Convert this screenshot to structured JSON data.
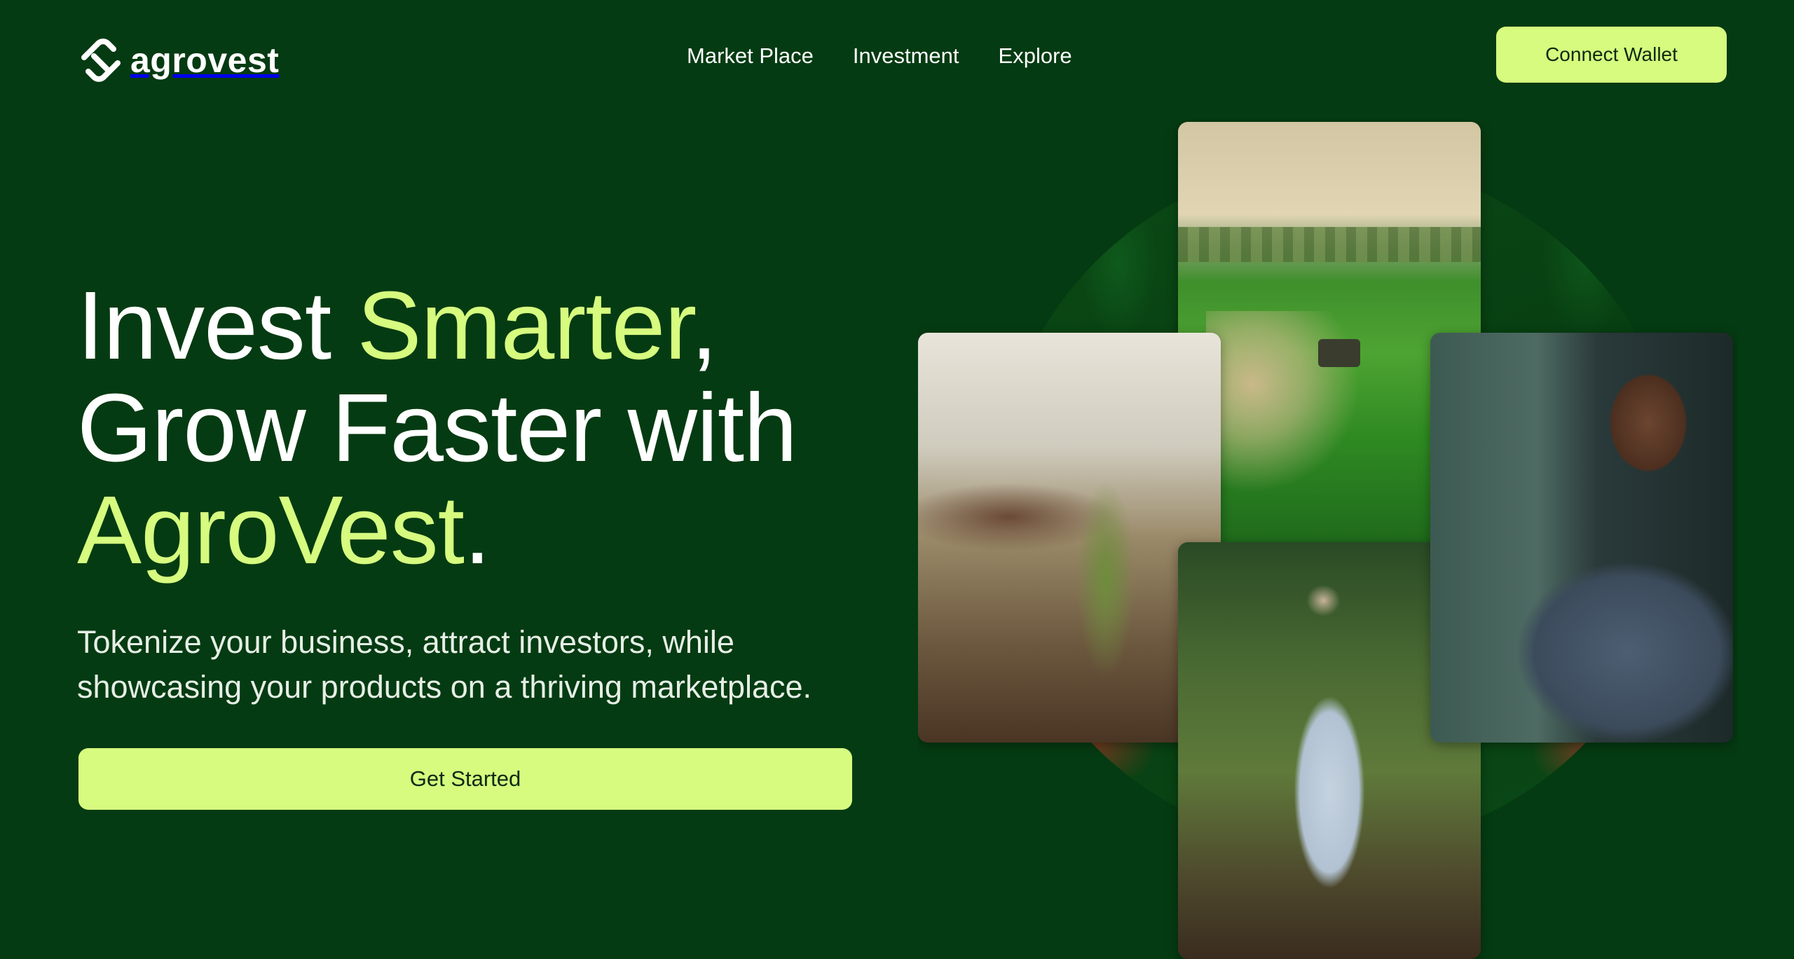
{
  "header": {
    "logo_text": "agrovest",
    "nav": [
      "Market Place",
      "Investment",
      "Explore"
    ],
    "connect_label": "Connect Wallet"
  },
  "hero": {
    "headline_invest": "Invest ",
    "headline_smarter": "Smarter",
    "headline_comma": ",",
    "headline_line2": "Grow Faster with",
    "headline_brand": "AgroVest",
    "headline_period": ".",
    "subtext": "Tokenize your business, attract investors, while showcasing your products on a thriving marketplace.",
    "cta_label": "Get Started"
  },
  "colors": {
    "background": "#053b12",
    "accent": "#d6fb7f",
    "text": "#ffffff"
  }
}
